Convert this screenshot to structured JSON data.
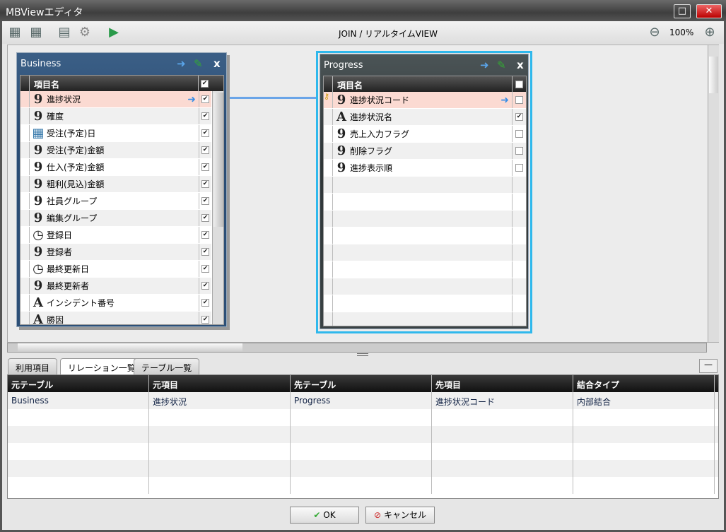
{
  "window": {
    "title": "MBViewエディタ"
  },
  "toolbar": {
    "title": "JOIN / リアルタイムVIEW",
    "zoom": "100%"
  },
  "tables": [
    {
      "name": "Business",
      "header": "項目名",
      "fields": [
        {
          "icon": "9",
          "label": "進捗状況",
          "checked": true,
          "selected": true,
          "link": true
        },
        {
          "icon": "9",
          "label": "確度",
          "checked": true
        },
        {
          "icon": "cal",
          "label": "受注(予定)日",
          "checked": true
        },
        {
          "icon": "9",
          "label": "受注(予定)金額",
          "checked": true
        },
        {
          "icon": "9",
          "label": "仕入(予定)金額",
          "checked": true
        },
        {
          "icon": "9",
          "label": "粗利(見込)金額",
          "checked": true
        },
        {
          "icon": "9",
          "label": "社員グループ",
          "checked": true
        },
        {
          "icon": "9",
          "label": "編集グループ",
          "checked": true
        },
        {
          "icon": "clock",
          "label": "登録日",
          "checked": true
        },
        {
          "icon": "9",
          "label": "登録者",
          "checked": true
        },
        {
          "icon": "clock",
          "label": "最終更新日",
          "checked": true
        },
        {
          "icon": "9",
          "label": "最終更新者",
          "checked": true
        },
        {
          "icon": "A",
          "label": "インシデント番号",
          "checked": true
        },
        {
          "icon": "A",
          "label": "勝因",
          "checked": true
        }
      ]
    },
    {
      "name": "Progress",
      "header": "項目名",
      "fields": [
        {
          "icon": "9",
          "label": "進捗状況コード",
          "checked": false,
          "selected": true,
          "link": true,
          "key": true
        },
        {
          "icon": "A",
          "label": "進捗状況名",
          "checked": true
        },
        {
          "icon": "9",
          "label": "売上入力フラグ",
          "checked": false
        },
        {
          "icon": "9",
          "label": "削除フラグ",
          "checked": false
        },
        {
          "icon": "9",
          "label": "進捗表示順",
          "checked": false
        }
      ]
    }
  ],
  "tabs": [
    "利用項目",
    "リレーション一覧",
    "テーブル一覧"
  ],
  "grid": {
    "columns": [
      "元テーブル",
      "元項目",
      "先テーブル",
      "先項目",
      "結合タイプ"
    ],
    "rows": [
      [
        "Business",
        "進捗状況",
        "Progress",
        "進捗状況コード",
        "内部結合"
      ]
    ]
  },
  "buttons": {
    "ok": "OK",
    "cancel": "キャンセル"
  }
}
